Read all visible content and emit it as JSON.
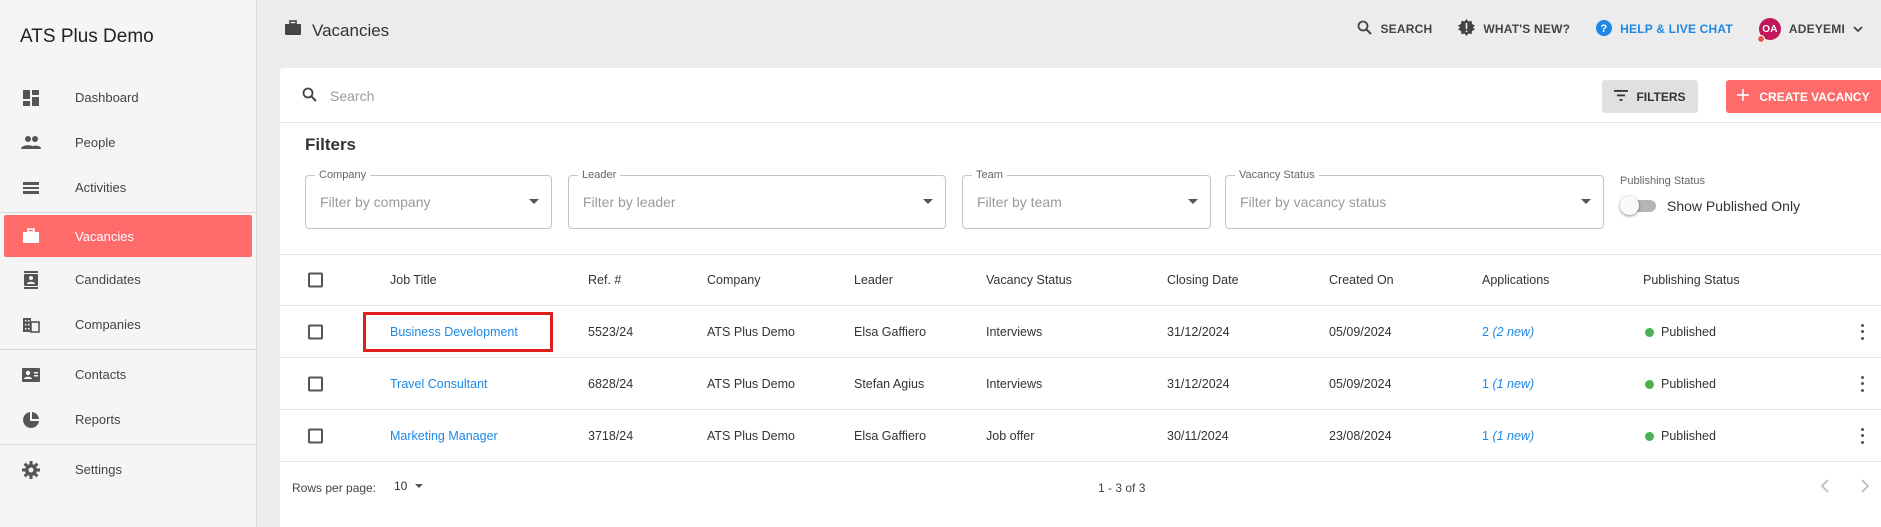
{
  "app": {
    "title": "ATS Plus Demo"
  },
  "sidebar": {
    "items": [
      {
        "label": "Dashboard",
        "icon": "dashboard-icon"
      },
      {
        "label": "People",
        "icon": "people-icon"
      },
      {
        "label": "Activities",
        "icon": "activities-icon"
      },
      {
        "label": "Vacancies",
        "icon": "briefcase-icon",
        "active": true
      },
      {
        "label": "Candidates",
        "icon": "candidates-icon"
      },
      {
        "label": "Companies",
        "icon": "companies-icon"
      },
      {
        "label": "Contacts",
        "icon": "contacts-icon"
      },
      {
        "label": "Reports",
        "icon": "reports-icon"
      },
      {
        "label": "Settings",
        "icon": "gear-icon"
      }
    ]
  },
  "header": {
    "title": "Vacancies",
    "search_label": "SEARCH",
    "whats_new_label": "WHAT'S NEW?",
    "help_label": "HELP & LIVE CHAT",
    "user_initials": "OA",
    "user_name": "ADEYEMI"
  },
  "toolbar": {
    "search_placeholder": "Search",
    "filters_label": "FILTERS",
    "create_label": "CREATE VACANCY"
  },
  "filters": {
    "title": "Filters",
    "company": {
      "legend": "Company",
      "placeholder": "Filter by company"
    },
    "leader": {
      "legend": "Leader",
      "placeholder": "Filter by leader"
    },
    "team": {
      "legend": "Team",
      "placeholder": "Filter by team"
    },
    "vacancy_status": {
      "legend": "Vacancy Status",
      "placeholder": "Filter by vacancy status"
    },
    "publishing": {
      "legend": "Publishing Status",
      "toggle_label": "Show Published Only",
      "toggle_on": false
    }
  },
  "table": {
    "columns": {
      "job_title": "Job Title",
      "ref": "Ref. #",
      "company": "Company",
      "leader": "Leader",
      "vacancy_status": "Vacancy Status",
      "closing_date": "Closing Date",
      "created_on": "Created On",
      "applications": "Applications",
      "publishing_status": "Publishing Status"
    },
    "rows": [
      {
        "job_title": "Business Development",
        "ref": "5523/24",
        "company": "ATS Plus Demo",
        "leader": "Elsa Gaffiero",
        "vacancy_status": "Interviews",
        "closing_date": "31/12/2024",
        "created_on": "05/09/2024",
        "applications_count": "2",
        "applications_new": "(2 new)",
        "publishing_status": "Published"
      },
      {
        "job_title": "Travel Consultant",
        "ref": "6828/24",
        "company": "ATS Plus Demo",
        "leader": "Stefan Agius",
        "vacancy_status": "Interviews",
        "closing_date": "31/12/2024",
        "created_on": "05/09/2024",
        "applications_count": "1",
        "applications_new": "(1 new)",
        "publishing_status": "Published"
      },
      {
        "job_title": "Marketing Manager",
        "ref": "3718/24",
        "company": "ATS Plus Demo",
        "leader": "Elsa Gaffiero",
        "vacancy_status": "Job offer",
        "closing_date": "30/11/2024",
        "created_on": "23/08/2024",
        "applications_count": "1",
        "applications_new": "(1 new)",
        "publishing_status": "Published"
      }
    ]
  },
  "pagination": {
    "rows_per_page_label": "Rows per page:",
    "rows_per_page_value": "10",
    "range": "1 - 3 of 3"
  },
  "colors": {
    "accent": "#ff6b6b",
    "link": "#1e88e5",
    "published": "#4caf50",
    "highlight": "#e02020"
  }
}
